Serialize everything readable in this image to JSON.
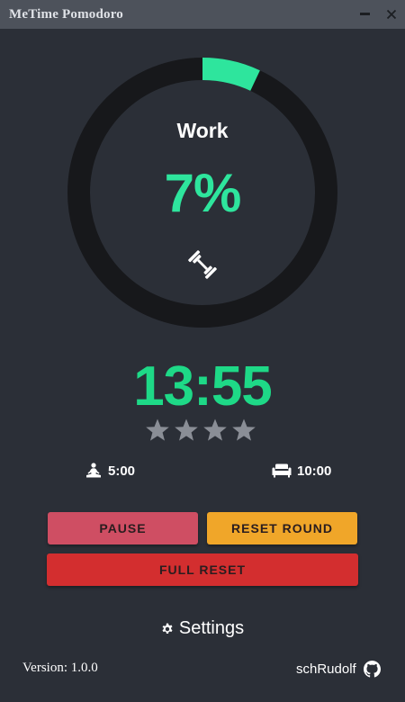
{
  "window": {
    "title": "MeTime Pomodoro",
    "minimize_icon": "minimize-icon",
    "close_icon": "close-icon"
  },
  "progress": {
    "phase": "Work",
    "percent_text": "7%",
    "fraction": 0.07,
    "phase_icon": "dumbbell-icon",
    "colors": {
      "track": "#17181b",
      "fill": "#2ee59d"
    }
  },
  "timer": {
    "time": "13:55",
    "rounds_total": 4,
    "rounds_completed": 0,
    "star_color": "#8a8e96"
  },
  "durations": {
    "short_break": "5:00",
    "short_break_icon": "meditation-icon",
    "long_break": "10:00",
    "long_break_icon": "couch-icon"
  },
  "buttons": {
    "pause": "PAUSE",
    "reset_round": "RESET ROUND",
    "full_reset": "FULL RESET",
    "colors": {
      "pause": "#cf4e63",
      "reset_round": "#f0a629",
      "full_reset": "#d32e2f"
    }
  },
  "settings": {
    "label": "Settings",
    "icon": "gear-icon"
  },
  "footer": {
    "version": "Version: 1.0.0",
    "author": "schRudolf",
    "author_icon": "github-icon"
  }
}
